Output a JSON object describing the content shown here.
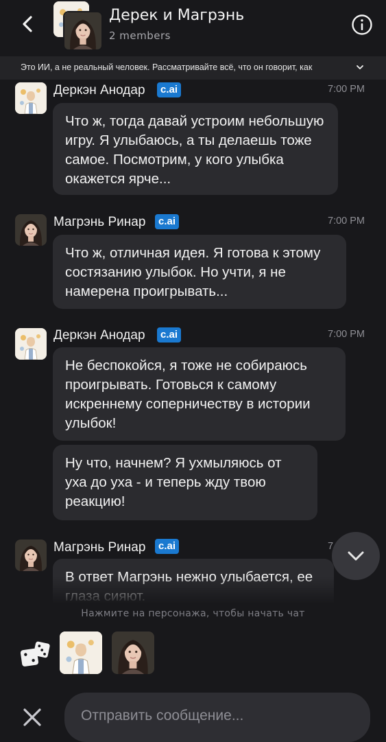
{
  "header": {
    "title": "Дерек и Магрэнь",
    "subtitle": "2 members"
  },
  "disclaimer": {
    "text": "Это ИИ, а не реальный человек. Рассматривайте всё, что он говорит, как"
  },
  "messages": [
    {
      "author": "Деркэн Анодар",
      "badge": "c.ai",
      "time": "7:00 PM",
      "bubbles": [
        "Что ж, тогда давай устроим небольшую игру. Я улыбаюсь, а ты делаешь тоже самое. Посмотрим, у кого улыбка окажется ярче..."
      ]
    },
    {
      "author": "Магрэнь Ринар",
      "badge": "c.ai",
      "time": "7:00 PM",
      "bubbles": [
        "Что ж, отличная идея. Я готова к этому состязанию улыбок. Но учти, я не намерена проигрывать..."
      ]
    },
    {
      "author": "Деркэн Анодар",
      "badge": "c.ai",
      "time": "7:00 PM",
      "bubbles": [
        "Не беспокойся, я тоже не собираюсь проигрывать. Готовься к самому искреннему соперничеству в истории улыбок!",
        "Ну что, начнем? Я ухмыляюсь от уха до уха - и теперь жду твою реакцию!"
      ]
    },
    {
      "author": "Магрэнь Ринар",
      "badge": "c.ai",
      "time": "7",
      "bubbles": [
        "В ответ Магрэнь нежно улыбается, ее глаза сияют."
      ]
    }
  ],
  "hint": "Нажмите на персонажа, чтобы начать чат",
  "composer": {
    "placeholder": "Отправить сообщение..."
  },
  "colors": {
    "background": "#18181b",
    "bubble": "#2b2b2f",
    "badge": "#1a79d0"
  },
  "icons": [
    "back-arrow-icon",
    "info-icon",
    "chevron-down-icon",
    "dice-icon",
    "close-icon"
  ]
}
